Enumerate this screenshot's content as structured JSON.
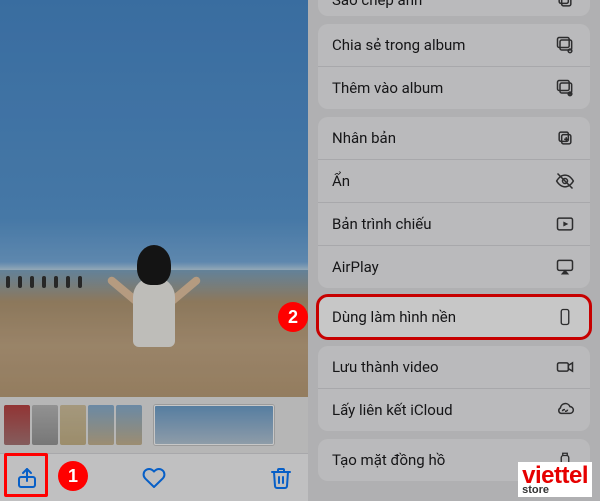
{
  "annotations": {
    "badge1": "1",
    "badge2": "2"
  },
  "logo": {
    "brand": "viettel",
    "sub": "store"
  },
  "menu": {
    "top_cut": "Sao chép ảnh",
    "group1": {
      "share_in_album": "Chia sẻ trong album",
      "add_to_album": "Thêm vào album"
    },
    "group2": {
      "duplicate": "Nhân bản",
      "hide": "Ẩn",
      "slideshow": "Bản trình chiếu",
      "airplay": "AirPlay"
    },
    "wallpaper": "Dùng làm hình nền",
    "group3": {
      "save_video": "Lưu thành video",
      "icloud_link": "Lấy liên kết iCloud"
    },
    "group4": {
      "watch_face": "Tạo mặt đồng hồ"
    }
  }
}
